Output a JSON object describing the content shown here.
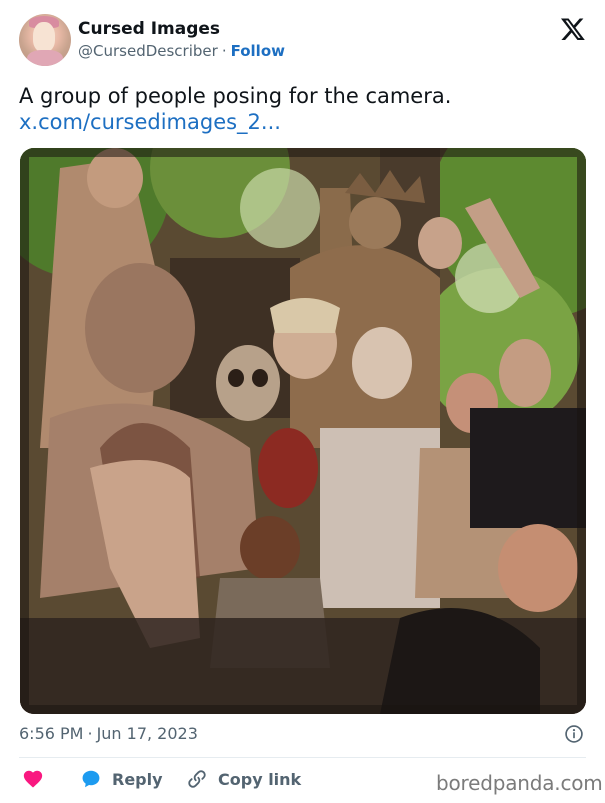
{
  "author": {
    "display_name": "Cursed Images",
    "handle": "@CursedDescriber",
    "separator": "·",
    "follow_label": "Follow"
  },
  "tweet": {
    "text": "A group of people posing for the camera.",
    "link": "x.com/cursedimages_2..."
  },
  "meta": {
    "time": "6:56 PM",
    "separator": "·",
    "date": "Jun 17, 2023"
  },
  "actions": {
    "reply_label": "Reply",
    "copy_label": "Copy link"
  },
  "watermark": "boredpanda.com",
  "icons": {
    "logo": "x-logo-icon",
    "info": "info-icon",
    "like": "heart-icon",
    "reply": "reply-bubble-icon",
    "copy": "link-icon"
  },
  "colors": {
    "link": "#1d6fc2",
    "secondary_text": "#536471",
    "heart": "#f91880",
    "reply_bubble": "#1d9bf0"
  }
}
